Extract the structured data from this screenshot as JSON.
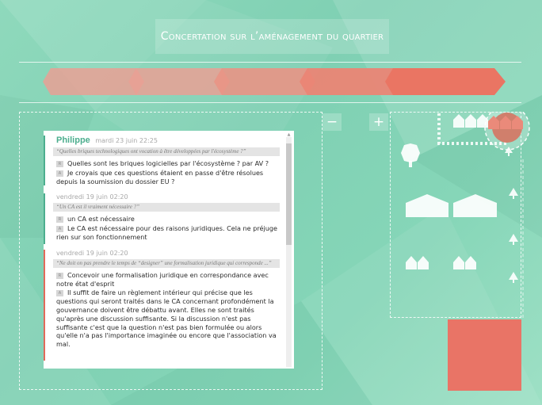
{
  "header": {
    "title": "Concertation sur l’aménagement du quartier"
  },
  "colors": {
    "background": "#86d6b8",
    "step_colors": [
      "#e9a094",
      "#e9a094",
      "#e99385",
      "#ea8575",
      "#ea7563"
    ],
    "selected_building": "#e97466",
    "thread_bars": [
      "#4cae8e",
      "#4cae8e",
      "#e16a5a"
    ],
    "author": "#4cae8e"
  },
  "steps": [
    {},
    {},
    {},
    {},
    {}
  ],
  "controls": {
    "zoom_out_label": "−",
    "zoom_in_label": "+"
  },
  "comments": [
    {
      "author": "Philippe",
      "date": "mardi 23 juin 22:25",
      "quote": "“Quelles briques technologiques ont vocation à être développées par l'écosystème ?”",
      "entries": [
        {
          "badge": "R",
          "text": "Quelles sont les briques logicielles par l'écosystème ? par AV ?"
        },
        {
          "badge": "A",
          "text": "Je croyais que ces questions étaient en passe d'être résolues depuis la soumission du dossier EU ?"
        }
      ]
    },
    {
      "author": "",
      "date": "vendredi 19 juin 02:20",
      "quote": "“Un CA est il vraiment nécessaire ?”",
      "entries": [
        {
          "badge": "R",
          "text": "un CA est nécessaire"
        },
        {
          "badge": "A",
          "text": "Le CA est nécessaire pour des raisons juridiques. Cela ne préjuge rien sur son fonctionnement"
        }
      ]
    },
    {
      "author": "",
      "date": "vendredi 19 juin 02:20",
      "quote": "“Ne doit on pas prendre le temps de “designer” une formalisation juridique qui corresponde ...”",
      "entries": [
        {
          "badge": "R",
          "text": "Concevoir une formalisation juridique en correspondance avec notre état d'esprit"
        },
        {
          "badge": "A",
          "text": "Il suffit de faire un règlement intérieur qui précise que les questions qui seront traités dans le CA concernant profondément la gouvernance doivent être débattu avant. Elles ne sont traités qu'après une discussion suffisante. Si la discussion n'est pas suffisante c'est que la question n'est pas bien formulée ou alors qu'elle n'a pas l'importance imaginée ou encore que l'association va mal."
        }
      ]
    }
  ]
}
